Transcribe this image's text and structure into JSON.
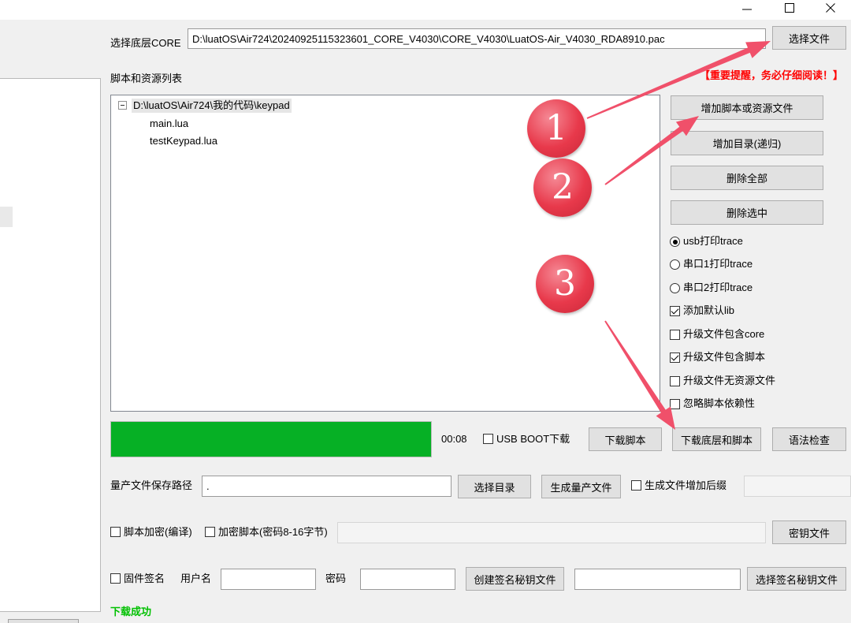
{
  "window": {
    "controls": [
      "minimize-icon",
      "maximize-icon",
      "close-icon"
    ]
  },
  "core": {
    "label": "选择底层CORE",
    "path": "D:\\luatOS\\Air724\\20240925115323601_CORE_V4030\\CORE_V4030\\LuatOS-Air_V4030_RDA8910.pac",
    "select_button": "选择文件"
  },
  "scripts": {
    "label": "脚本和资源列表",
    "notice": "【重要提醒，务必仔细阅读！】",
    "tree": {
      "expanded": true,
      "root": "D:\\luatOS\\Air724\\我的代码\\keypad",
      "children": [
        "main.lua",
        "testKeypad.lua"
      ]
    },
    "buttons": {
      "add_files": "增加脚本或资源文件",
      "add_dir": "增加目录(递归)",
      "delete_all": "删除全部",
      "delete_selected": "删除选中"
    }
  },
  "trace": [
    {
      "label": "usb打印trace",
      "selected": true
    },
    {
      "label": "串口1打印trace",
      "selected": false
    },
    {
      "label": "串口2打印trace",
      "selected": false
    }
  ],
  "options": [
    {
      "label": "添加默认lib",
      "checked": true
    },
    {
      "label": "升级文件包含core",
      "checked": false
    },
    {
      "label": "升级文件包含脚本",
      "checked": true
    },
    {
      "label": "升级文件无资源文件",
      "checked": false
    },
    {
      "label": "忽略脚本依赖性",
      "checked": false
    }
  ],
  "download": {
    "progress_percent": 100,
    "elapsed": "00:08",
    "usb_boot": {
      "label": "USB BOOT下载",
      "checked": false
    },
    "download_script": "下载脚本",
    "download_core_script": "下载底层和脚本",
    "syntax_check": "语法检查",
    "status": "下载成功"
  },
  "mass_production": {
    "label": "量产文件保存路径",
    "path": ".",
    "select_dir": "选择目录",
    "generate": "生成量产文件",
    "suffix": {
      "label": "生成文件增加后缀",
      "checked": false
    }
  },
  "encryption": {
    "compile": {
      "label": "脚本加密(编译)",
      "checked": false
    },
    "encrypt": {
      "label": "加密脚本(密码8-16字节)",
      "checked": false
    },
    "key_file": "密钥文件"
  },
  "signing": {
    "firmware_sign": {
      "label": "固件签名",
      "checked": false
    },
    "username_label": "用户名",
    "password_label": "密码",
    "create_key": "创建签名秘钥文件",
    "select_key": "选择签名秘钥文件"
  },
  "annotations": {
    "markers": [
      "1",
      "2",
      "3"
    ]
  },
  "colors": {
    "progress_fill": "#06b025",
    "notice_text": "#ff0000",
    "success_text": "#00c000",
    "annotation_red": "#e8394b",
    "arrow": "#f0506a"
  }
}
